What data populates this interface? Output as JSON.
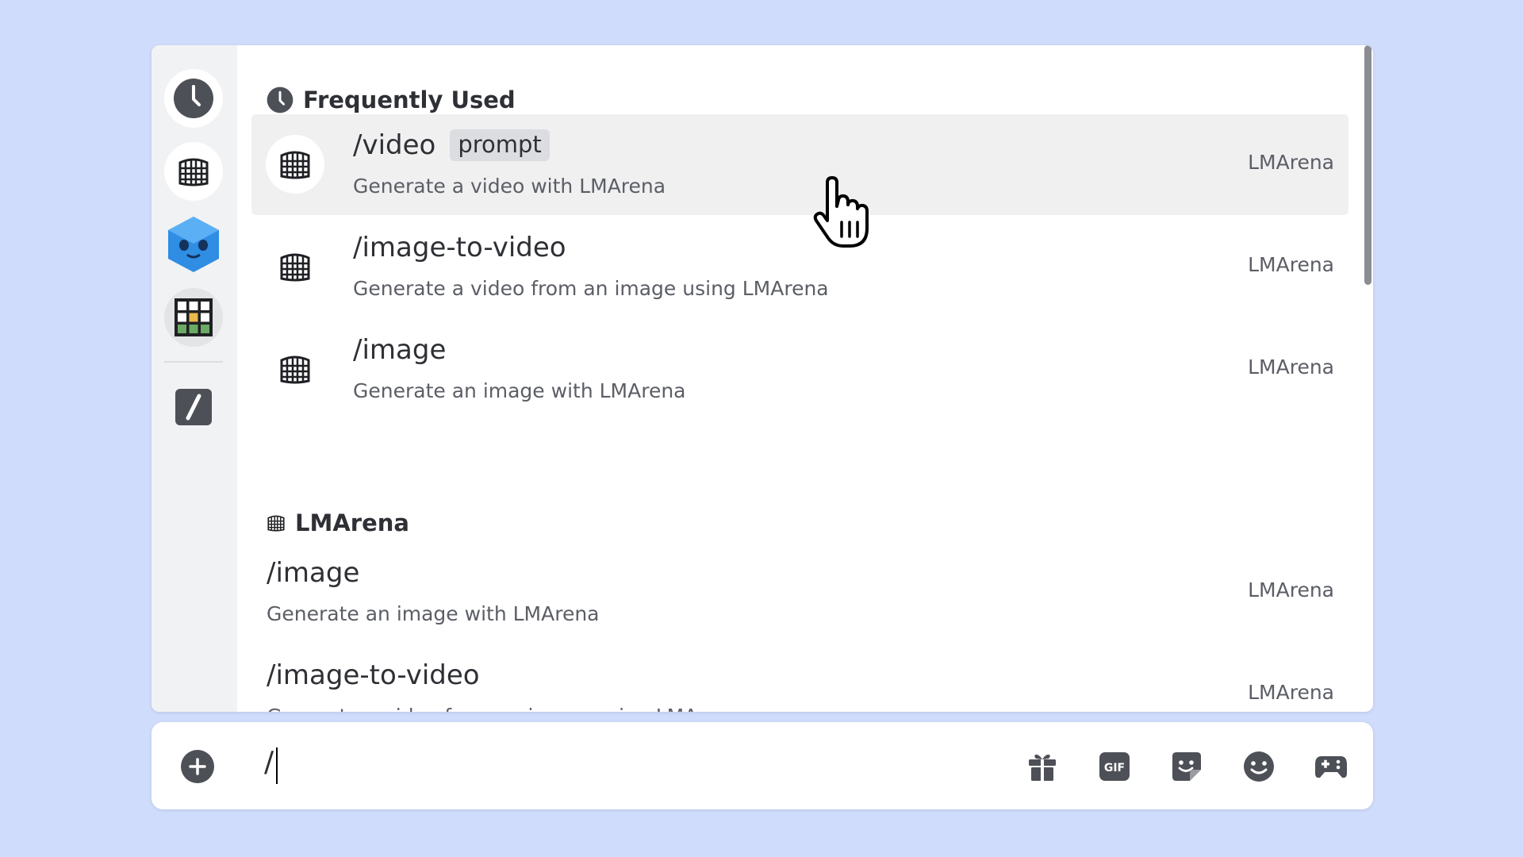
{
  "colors": {
    "background": "#cfdcfb",
    "panel": "#ffffff",
    "rail": "#f1f2f3",
    "selected_row": "#f0f0f1",
    "text_primary": "#2e3035",
    "text_secondary": "#5c5e66",
    "icon_gray": "#4e5058",
    "bot_blue": "#2f8de4"
  },
  "sidebar": {
    "items": [
      {
        "icon": "clock-icon"
      },
      {
        "icon": "lmarena-app-icon"
      },
      {
        "icon": "blue-bot-app-icon"
      },
      {
        "icon": "grid-app-icon"
      },
      {
        "icon": "slash-command-icon"
      }
    ]
  },
  "sections": [
    {
      "title": "Frequently Used",
      "icon": "clock-icon",
      "items": [
        {
          "name": "/video",
          "tag": "prompt",
          "description": "Generate a video with LMArena",
          "source": "LMArena",
          "selected": true
        },
        {
          "name": "/image-to-video",
          "description": "Generate a video from an image using LMArena",
          "source": "LMArena"
        },
        {
          "name": "/image",
          "description": "Generate an image with LMArena",
          "source": "LMArena"
        }
      ]
    },
    {
      "title": "LMArena",
      "icon": "lmarena-app-icon",
      "items": [
        {
          "name": "/image",
          "description": "Generate an image with LMArena",
          "source": "LMArena"
        },
        {
          "name": "/image-to-video",
          "description": "Generate a video from an image using LMArena",
          "source": "LMArena"
        }
      ]
    }
  ],
  "input": {
    "value": "/"
  },
  "toolbar_icons": [
    "gift-icon",
    "gif-icon",
    "sticker-icon",
    "emoji-icon",
    "game-controller-icon"
  ],
  "gif_label": "GIF"
}
